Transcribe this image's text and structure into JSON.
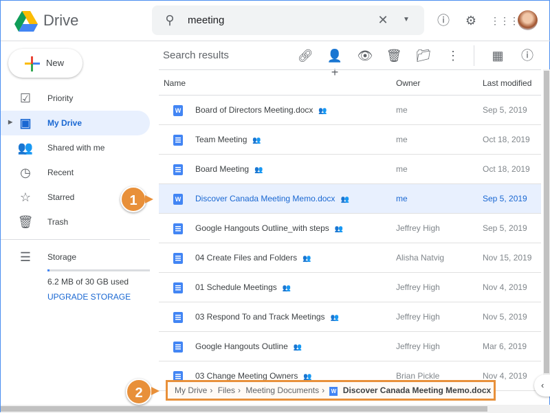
{
  "app": {
    "title": "Drive"
  },
  "search": {
    "query": "meeting"
  },
  "sidebar": {
    "new_label": "New",
    "items": [
      {
        "label": "Priority",
        "icon": "priority-icon"
      },
      {
        "label": "My Drive",
        "icon": "my-drive-icon"
      },
      {
        "label": "Shared with me",
        "icon": "shared-icon"
      },
      {
        "label": "Recent",
        "icon": "clock-icon"
      },
      {
        "label": "Starred",
        "icon": "star-icon"
      },
      {
        "label": "Trash",
        "icon": "trash-icon"
      }
    ],
    "storage": {
      "label": "Storage",
      "used": "6.2 MB of 30 GB used",
      "upgrade": "UPGRADE STORAGE",
      "fill_percent": 0.02
    }
  },
  "main": {
    "title": "Search results",
    "columns": {
      "name": "Name",
      "owner": "Owner",
      "modified": "Last modified"
    },
    "rows": [
      {
        "name": "Board of Directors Meeting.docx",
        "type": "word",
        "owner": "me",
        "modified": "Sep 5, 2019"
      },
      {
        "name": "Team Meeting",
        "type": "gdoc",
        "owner": "me",
        "modified": "Oct 18, 2019"
      },
      {
        "name": "Board Meeting",
        "type": "gdoc",
        "owner": "me",
        "modified": "Oct 18, 2019"
      },
      {
        "name": "Discover Canada Meeting Memo.docx",
        "type": "word",
        "owner": "me",
        "modified": "Sep 5, 2019",
        "selected": true
      },
      {
        "name": "Google Hangouts Outline_with steps",
        "type": "gdoc",
        "owner": "Jeffrey High",
        "modified": "Sep 5, 2019"
      },
      {
        "name": "04 Create Files and Folders",
        "type": "gdoc",
        "owner": "Alisha Natvig",
        "modified": "Nov 15, 2019"
      },
      {
        "name": "01 Schedule Meetings",
        "type": "gdoc",
        "owner": "Jeffrey High",
        "modified": "Nov 4, 2019"
      },
      {
        "name": "03 Respond To and Track Meetings",
        "type": "gdoc",
        "owner": "Jeffrey High",
        "modified": "Nov 5, 2019"
      },
      {
        "name": "Google Hangouts Outline",
        "type": "gdoc",
        "owner": "Jeffrey High",
        "modified": "Mar 6, 2019"
      },
      {
        "name": "03 Change Meeting Owners",
        "type": "gdoc",
        "owner": "Brian Pickle",
        "modified": "Nov 4, 2019"
      }
    ]
  },
  "breadcrumb": [
    "My Drive",
    "Files",
    "Meeting Documents",
    "Discover Canada Meeting Memo.docx"
  ],
  "callouts": [
    "1",
    "2"
  ],
  "colors": {
    "accent": "#1967d2",
    "callout": "#e8903a",
    "selected_row": "#e8f0fe"
  }
}
